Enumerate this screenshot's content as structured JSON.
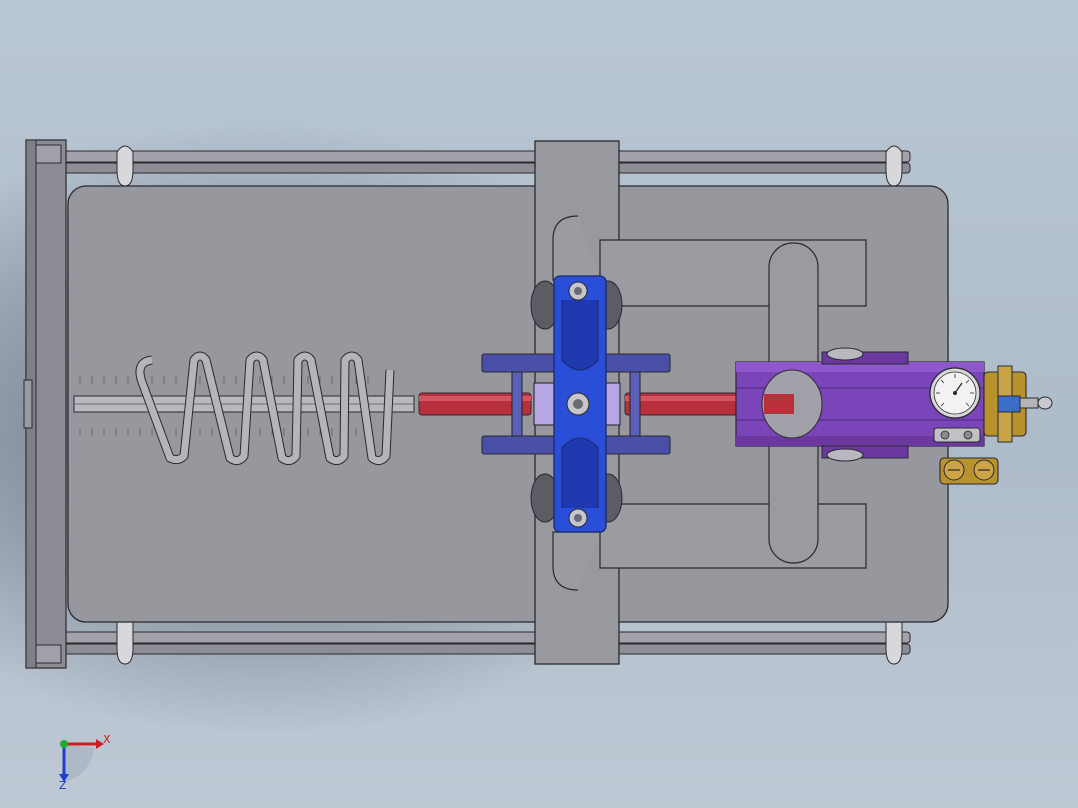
{
  "triad": {
    "x_label": "X",
    "z_label": "Z",
    "x_color": "#cc1f1f",
    "z_color": "#1f3fcc",
    "origin_color": "#22aa33"
  },
  "colors": {
    "background": "#b4c1ce",
    "plate": "#97979e",
    "frame": "#8c8c94",
    "rail": "#9a9aa3",
    "outline": "#2a2a2e",
    "clamp_blue": "#2a4ed8",
    "bracket_indigo": "#4a4fa8",
    "rod_red": "#b8303c",
    "cylinder_purple": "#7a45b8",
    "fitting_brass": "#b8922c",
    "gauge_face": "#f2f2f2"
  },
  "parts": [
    "base-plate",
    "end-frame",
    "guide-rail",
    "compression-spring",
    "threaded-shaft",
    "clamp-block",
    "bearing-bracket",
    "piston-rod",
    "pneumatic-cylinder",
    "pressure-gauge",
    "air-fitting"
  ]
}
